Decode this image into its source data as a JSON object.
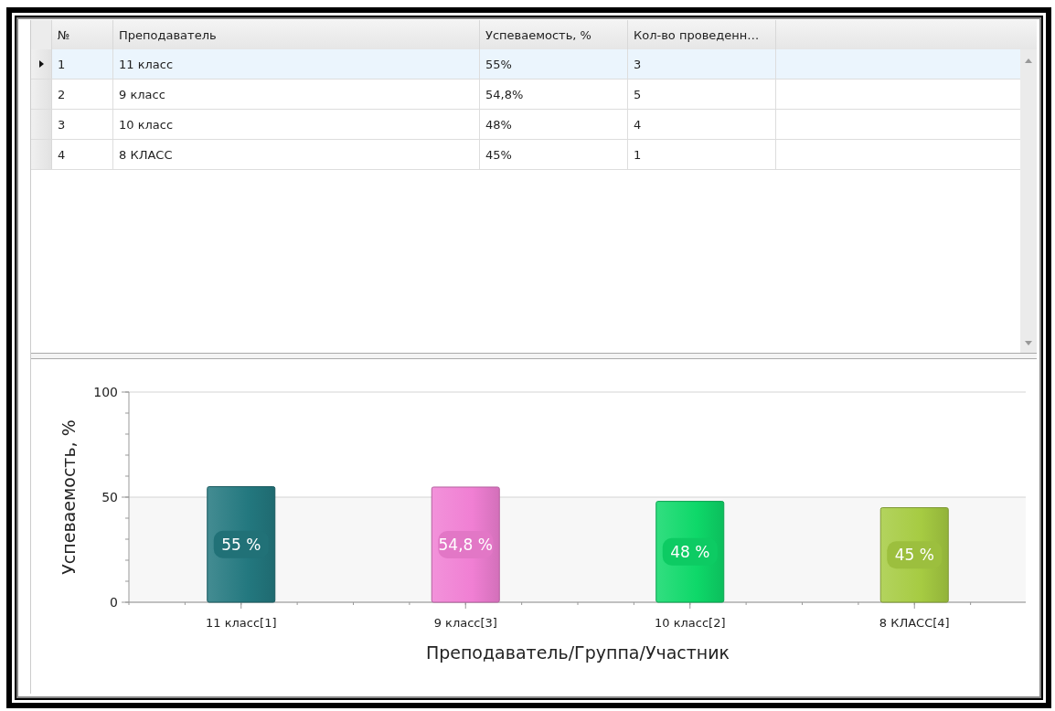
{
  "table": {
    "columns": [
      "№",
      "Преподаватель",
      "Успеваемость, %",
      "Кол-во проведенн…"
    ],
    "rows": [
      {
        "cells": [
          "1",
          "11 класс",
          "55%",
          "3"
        ],
        "selected": true
      },
      {
        "cells": [
          "2",
          "9 класс",
          "54,8%",
          "5"
        ],
        "selected": false
      },
      {
        "cells": [
          "3",
          "10 класс",
          "48%",
          "4"
        ],
        "selected": false
      },
      {
        "cells": [
          "4",
          "8 КЛАСС",
          "45%",
          "1"
        ],
        "selected": false
      }
    ]
  },
  "chart": {
    "chart_data": {
      "type": "bar",
      "xlabel": "Преподаватель/Группа/Участник",
      "ylabel": "Успеваемость, %",
      "categories": [
        "11 класс[1]",
        "9 класс[3]",
        "10 класс[2]",
        "8 КЛАСС[4]"
      ],
      "series": [
        {
          "values": [
            55,
            54.8,
            48,
            45
          ]
        }
      ],
      "ylim": [
        0,
        100
      ],
      "yticks": [
        0,
        50,
        100
      ],
      "bands": [
        {
          "axis": "y",
          "from": 0,
          "to": 50
        }
      ],
      "value_labels": [
        "55 %",
        "54,8 %",
        "48 %",
        "45 %"
      ]
    },
    "bars": [
      {
        "color": "#23787f"
      },
      {
        "color": "#f07fd3"
      },
      {
        "color": "#0ed869"
      },
      {
        "color": "#a6cb42"
      }
    ]
  }
}
